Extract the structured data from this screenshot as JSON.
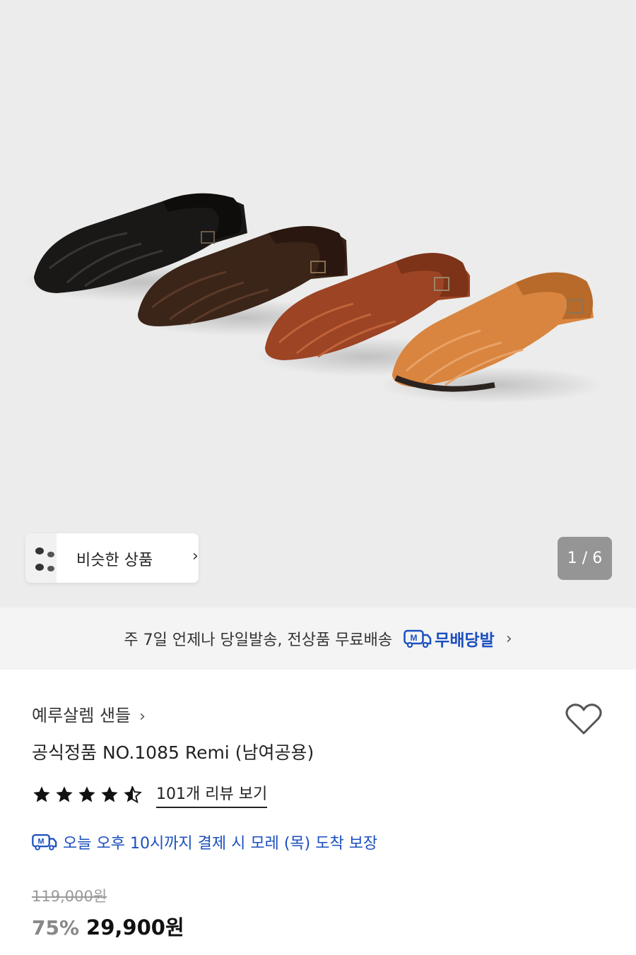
{
  "gallery": {
    "pager": "1 / 6",
    "similar_label": "비슷한 상품",
    "similar_chevron": "›"
  },
  "shipping_bar": {
    "text": "주 7일 언제나 당일발송, 전상품 무료배송",
    "badge_label": "무배당발",
    "badge_icon_letter": "M",
    "chevron": "›"
  },
  "product": {
    "brand": "예루살렘 샌들",
    "brand_chevron": "›",
    "title": "공식정품 NO.1085 Remi (남여공용)",
    "rating": 4.5,
    "review_link": "101개 리뷰 보기",
    "delivery_icon_letter": "M",
    "delivery_text": "오늘 오후 10시까지 결제 시 모레 (목) 도착 보장",
    "original_price": "119,000원",
    "discount": "75%",
    "sale_price": "29,900원"
  },
  "colors": {
    "accent_blue": "#1b4fbf",
    "hero_bg": "#ececec",
    "shipping_bg": "#f4f4f4"
  },
  "icons": [
    "heart-icon",
    "star-icon",
    "truck-m-icon",
    "chevron-right-icon"
  ]
}
